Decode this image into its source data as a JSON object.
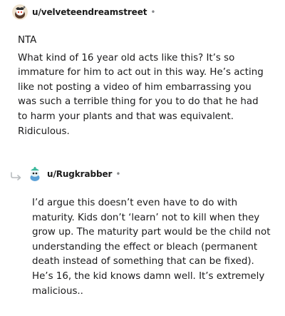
{
  "comments": [
    {
      "username": "u/velveteendreamstreet",
      "separator": "•",
      "paragraphs": [
        "NTA",
        "What kind of 16 year old acts like this? It’s so immature for him to act out in this way. He’s acting like not posting a video of him embarrassing you was such a terrible thing for you to do that he had to harm your plants and that was equivalent. Ridiculous."
      ]
    },
    {
      "username": "u/Rugkrabber",
      "separator": "•",
      "paragraphs": [
        "I’d argue this doesn’t even have to do with maturity. Kids don’t ‘learn’ not to kill when they grow up. The maturity part would be the child not understanding the effect or bleach (permanent death instead of something that can be fixed). He’s 16, the kid knows damn well. It’s extremely malicious.."
      ]
    }
  ],
  "icons": {
    "avatar_1": "reddit-snoo-avatar-icon",
    "avatar_2": "reddit-snoo-avatar-icon",
    "reply": "reply-arrow-icon"
  },
  "colors": {
    "text": "#1a1a1b",
    "meta": "#878a8c",
    "avatar_1_bg": "#e8d9c4",
    "avatar_2_bg": "#7fd6c6"
  }
}
